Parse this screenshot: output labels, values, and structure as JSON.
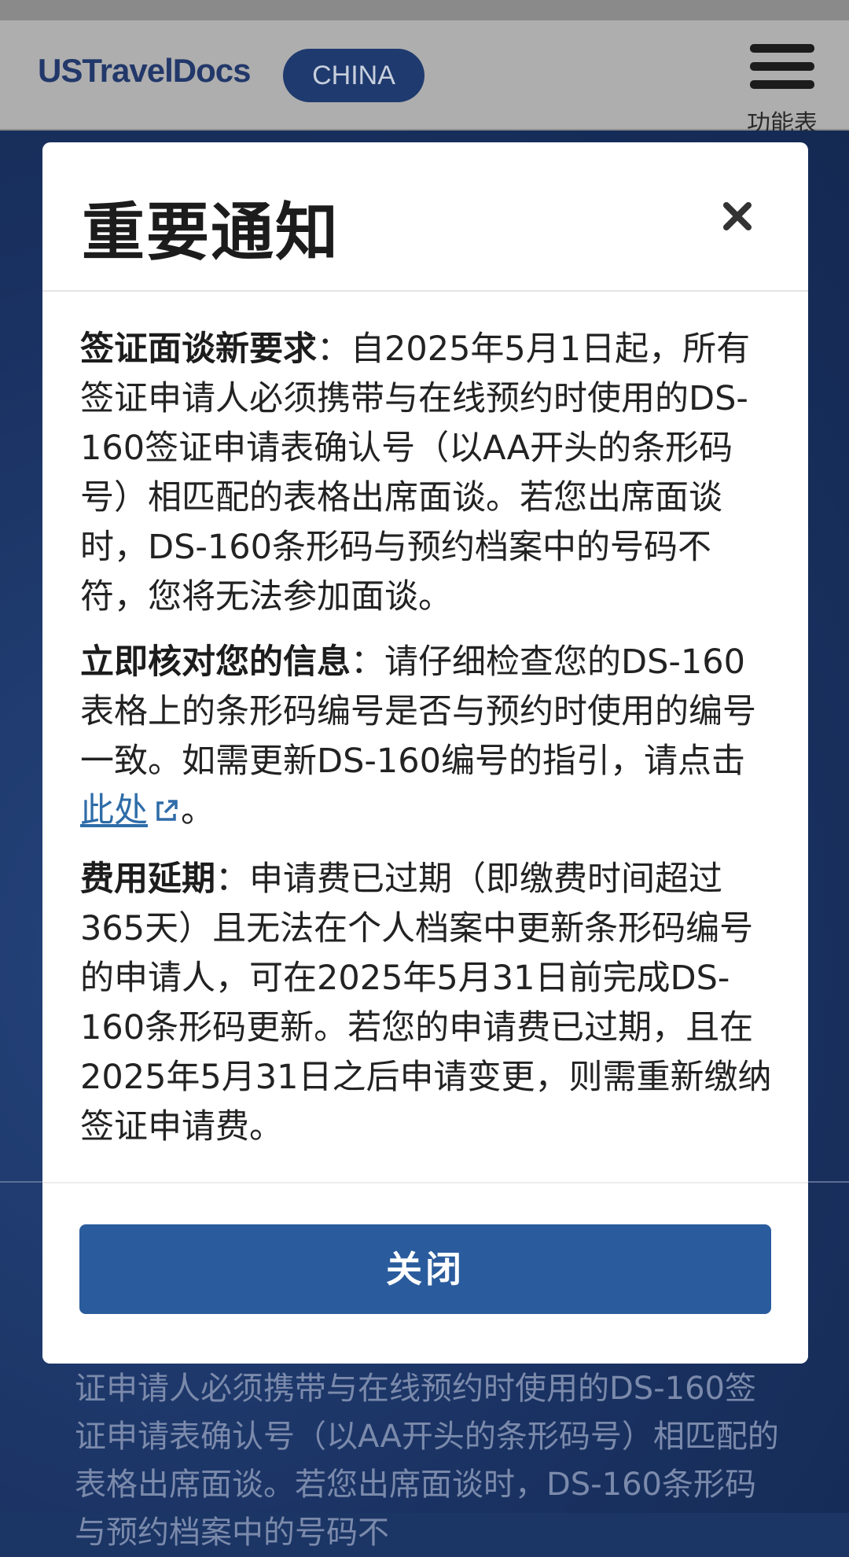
{
  "header": {
    "logo": "USTravelDocs",
    "country": "CHINA",
    "menu_label": "功能表"
  },
  "modal": {
    "title": "重要通知",
    "sections": [
      {
        "heading": "签证面谈新要求",
        "text": "：自2025年5月1日起，所有签证申请人必须携带与在线预约时使用的DS-160签证申请表确认号（以AA开头的条形码号）相匹配的表格出席面谈。若您出席面谈时，DS-160条形码与预约档案中的号码不符，您将无法参加面谈。"
      },
      {
        "heading": "立即核对您的信息",
        "text": "：请仔细检查您的DS-160表格上的条形码编号是否与预约时使用的编号一致。如需更新DS-160编号的指引，请点击",
        "link": "此处",
        "after_link": "。"
      },
      {
        "heading": "费用延期",
        "text": "：申请费已过期（即缴费时间超过365天）且无法在个人档案中更新条形码编号的申请人，可在2025年5月31日前完成DS-160条形码更新。若您的申请费已过期，且在2025年5月31日之后申请变更，则需重新缴纳签证申请费。"
      }
    ],
    "close_button": "关闭"
  },
  "background": {
    "text": "证申请人必须携带与在线预约时使用的DS-160签证申请表确认号（以AA开头的条形码号）相匹配的表格出席面谈。若您出席面谈时，DS-160条形码与预约档案中的号码不"
  },
  "colors": {
    "navy": "#1f3a6e",
    "button": "#2a5c9d",
    "link": "#2e6ca8"
  }
}
